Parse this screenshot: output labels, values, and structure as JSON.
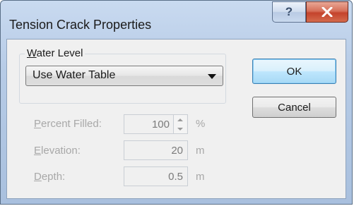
{
  "window": {
    "title": "Tension Crack Properties",
    "help_glyph": "?",
    "close_glyph": "X"
  },
  "water_level": {
    "group_label_key": "W",
    "group_label_rest": "ater Level",
    "selected": "Use Water Table"
  },
  "buttons": {
    "ok_label": "OK",
    "cancel_label": "Cancel"
  },
  "fields": {
    "percent_filled": {
      "label_key": "P",
      "label_rest": "ercent Filled:",
      "value": "100",
      "unit": "%",
      "enabled": false
    },
    "elevation": {
      "label_key": "E",
      "label_rest": "levation:",
      "value": "20",
      "unit": "m",
      "enabled": false
    },
    "depth": {
      "label_key": "D",
      "label_rest": "epth:",
      "value": "0.5",
      "unit": "m",
      "enabled": false
    }
  },
  "colors": {
    "close_button": "#c4432c",
    "ok_button_border": "#3c7fb1",
    "disabled_text": "#a8a8a8"
  }
}
